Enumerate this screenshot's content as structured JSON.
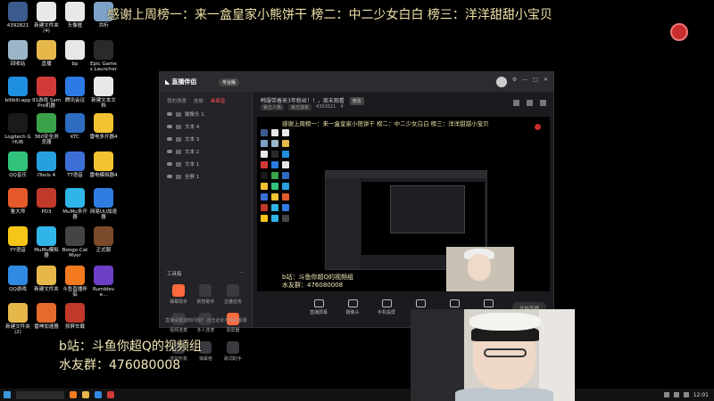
{
  "overlay": {
    "top_banner": "感谢上周榜一：来一盒皇家小熊饼干 榜二：中二少女白白 榜三：洋洋甜甜小宝贝",
    "bottom_line1": "b站：斗鱼你超Q的视频组",
    "bottom_line2": "水友群：476080008"
  },
  "desktop_icons": [
    {
      "label": "4392821",
      "icon": "app-icon",
      "color": "#3b5b8c"
    },
    {
      "label": "新建文件夹 (4)",
      "icon": "file-icon",
      "color": "#e8e8e8"
    },
    {
      "label": "头像框",
      "icon": "file-icon",
      "color": "#e8e8e8"
    },
    {
      "label": "共听",
      "icon": "user-icon",
      "color": "#7da2c7"
    },
    {
      "label": "回收站",
      "icon": "recycle-bin-icon",
      "color": "#9cb6c9"
    },
    {
      "label": "直播",
      "icon": "folder-icon",
      "color": "#e6b84a"
    },
    {
      "label": "bp",
      "icon": "file-icon",
      "color": "#e8e8e8"
    },
    {
      "label": "Epic Games Launcher",
      "icon": "epic-icon",
      "color": "#2a2a2a"
    },
    {
      "label": "bilibili-app",
      "icon": "app-icon",
      "color": "#1f8fe0"
    },
    {
      "label": "91游戏 SamPro机器",
      "icon": "app-icon",
      "color": "#d23a3a"
    },
    {
      "label": "腾讯会议",
      "icon": "app-icon",
      "color": "#2c7be5"
    },
    {
      "label": "新建文本文档",
      "icon": "file-icon",
      "color": "#e8e8e8"
    },
    {
      "label": "Logitech G HUB",
      "icon": "app-icon",
      "color": "#1a1a1a"
    },
    {
      "label": "360安全浏览器",
      "icon": "app-icon",
      "color": "#3aa34a"
    },
    {
      "label": "KTC",
      "icon": "app-icon",
      "color": "#2d6cc0"
    },
    {
      "label": "雷电多开器4",
      "icon": "app-icon",
      "color": "#f2c230"
    },
    {
      "label": "QQ音乐",
      "icon": "app-icon",
      "color": "#31c27c"
    },
    {
      "label": "iTools 4",
      "icon": "app-icon",
      "color": "#27a0e0"
    },
    {
      "label": "TT语音",
      "icon": "app-icon",
      "color": "#3b6fd6"
    },
    {
      "label": "雷电模拟器4",
      "icon": "app-icon",
      "color": "#f2c230"
    },
    {
      "label": "鲁大师",
      "icon": "app-icon",
      "color": "#e55a2b"
    },
    {
      "label": "PD3",
      "icon": "app-icon",
      "color": "#c0392b"
    },
    {
      "label": "MuMu多开器",
      "icon": "app-icon",
      "color": "#2fb5e8"
    },
    {
      "label": "网易UU加速器",
      "icon": "app-icon",
      "color": "#2f7de1"
    },
    {
      "label": "YY语音",
      "icon": "app-icon",
      "color": "#f5c518"
    },
    {
      "label": "MuMu模拟器",
      "icon": "app-icon",
      "color": "#2fb5e8"
    },
    {
      "label": "Bongo Cat Mver",
      "icon": "app-icon",
      "color": "#444"
    },
    {
      "label": "正式服",
      "icon": "app-icon",
      "color": "#7b4a2a"
    },
    {
      "label": "QQ游戏",
      "icon": "app-icon",
      "color": "#2f8ae1"
    },
    {
      "label": "新建文件夹",
      "icon": "folder-icon",
      "color": "#e6b84a"
    },
    {
      "label": "斗鱼直播伴侣",
      "icon": "app-icon",
      "color": "#f47a1f"
    },
    {
      "label": "Rumbleve...",
      "icon": "app-icon",
      "color": "#6d3fc7"
    },
    {
      "label": "新建文件夹 (2)",
      "icon": "folder-icon",
      "color": "#e6b84a"
    },
    {
      "label": "雷神加速器",
      "icon": "app-icon",
      "color": "#e56b2a"
    },
    {
      "label": "抓屏车载",
      "icon": "app-icon",
      "color": "#c0392b"
    }
  ],
  "app": {
    "title": "直播伴侣",
    "pro_chip": "专业版",
    "side_tabs": [
      "我的场景",
      "皮肤",
      "画面音"
    ],
    "active_tab": 2,
    "scenes": [
      "摄像头 1",
      "文本 4",
      "文本 3",
      "文本 2",
      "文本 1",
      "全屏 1"
    ],
    "tools_title": "工具箱",
    "tools": [
      {
        "label": "弹幕助手",
        "hot": true
      },
      {
        "label": "房管助手",
        "hot": false
      },
      {
        "label": "主播任务",
        "hot": false
      },
      {
        "label": "视频连麦",
        "hot": false
      },
      {
        "label": "多人连麦",
        "hot": false
      },
      {
        "label": "录屏器",
        "hot": true
      },
      {
        "label": "虚拟形象",
        "hot": false
      },
      {
        "label": "弹幕卷",
        "hot": false
      },
      {
        "label": "歌词助手",
        "hot": false
      }
    ],
    "notice": "直播设置遇到问题？ 点击此处可联系客服",
    "room_title": "韩服带着来3年粉丝！！，周末观看",
    "room_edit": "修改",
    "room_meta": [
      "第五人格",
      "第五独家",
      "4392821",
      "4"
    ],
    "preview_banner": "感谢上周榜一：来一盒皇家小熊饼干 榜二：中二少女白白 榜三：洋洋甜甜小宝贝",
    "preview_bottom1": "b站：斗鱼你超Q的视频组",
    "preview_bottom2": "水友群：476080008",
    "controls": [
      "直播屏幕",
      "摄像头",
      "手机投屏",
      "多媒体",
      "麦克风",
      "扬声器"
    ],
    "start_button": "开始直播"
  },
  "taskbar": {
    "clock": "12:01"
  }
}
